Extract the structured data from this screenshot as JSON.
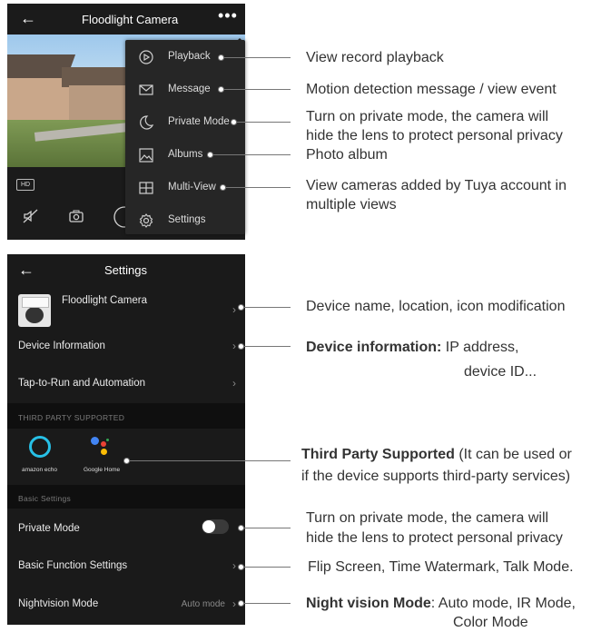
{
  "panel1": {
    "title": "Floodlight Camera",
    "back_icon": "arrow-left-icon",
    "more_icon": "more-horizontal-icon",
    "hd_badge": "HD",
    "menu": [
      {
        "icon": "playback-icon",
        "label": "Playback"
      },
      {
        "icon": "message-icon",
        "label": "Message"
      },
      {
        "icon": "moon-icon",
        "label": "Private Mode"
      },
      {
        "icon": "image-icon",
        "label": "Albums"
      },
      {
        "icon": "grid-icon",
        "label": "Multi-View"
      },
      {
        "icon": "gear-icon",
        "label": "Settings"
      }
    ]
  },
  "panel2": {
    "title": "Settings",
    "device_name": "Floodlight Camera",
    "device_information": "Device Information",
    "tap_to_run": "Tap-to-Run and Automation",
    "third_party_header": "THIRD PARTY SUPPORTED",
    "amazon_label": "amazon echo",
    "google_label": "Google Home",
    "basic_settings_header": "Basic Settings",
    "private_mode": "Private Mode",
    "private_mode_on": false,
    "basic_function_settings": "Basic Function Settings",
    "nightvision_mode": "Nightvision Mode",
    "nightvision_value": "Auto mode"
  },
  "annotations": {
    "playback": "View record playback",
    "message": "Motion detection message / view event",
    "private_1": "Turn on private mode, the camera will",
    "private_2": "hide the lens to protect personal privacy",
    "albums": "Photo album",
    "multiview_1": "View cameras added by Tuya account in",
    "multiview_2": "multiple views",
    "device_name": "Device name, location, icon modification",
    "devinfo_bold": "Device information:",
    "devinfo_rest": " IP address,",
    "devinfo_2": "device ID...",
    "third_bold": "Third Party Supported",
    "third_rest": " (It can be used or",
    "third_2": "if the device supports third-party services)",
    "private2_1": "Turn on private mode, the camera will",
    "private2_2": "hide the lens to protect personal privacy",
    "basic_func": "Flip Screen, Time Watermark, Talk Mode.",
    "night_bold": "Night vision Mode",
    "night_rest": ": Auto mode, IR Mode,",
    "night_2": "Color Mode"
  }
}
